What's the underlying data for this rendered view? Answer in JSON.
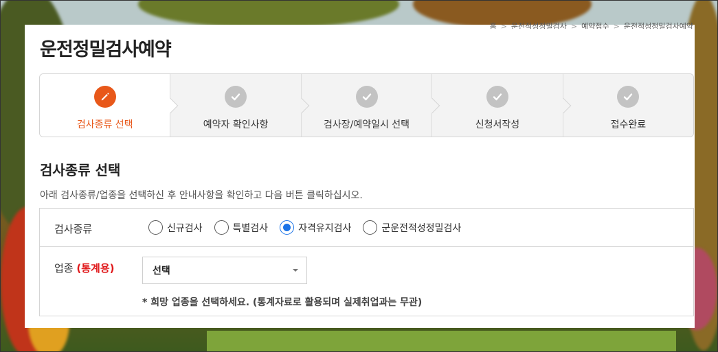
{
  "breadcrumb": [
    "홈",
    "운전적성정밀검사",
    "예약접수",
    "운전적성정밀검사예약"
  ],
  "page_title": "운전정밀검사예약",
  "steps": [
    {
      "label": "검사종류 선택",
      "icon": "pencil-icon",
      "active": true
    },
    {
      "label": "예약자 확인사항",
      "icon": "check-icon",
      "active": false
    },
    {
      "label": "검사장/예약일시 선택",
      "icon": "check-icon",
      "active": false
    },
    {
      "label": "신청서작성",
      "icon": "check-icon",
      "active": false
    },
    {
      "label": "접수완료",
      "icon": "check-icon",
      "active": false
    }
  ],
  "section": {
    "title": "검사종류 선택",
    "description": "아래 검사종류/업종을 선택하신 후 안내사항을 확인하고 다음 버튼 클릭하십시오."
  },
  "form": {
    "exam_type": {
      "label": "검사종류",
      "options": [
        "신규검사",
        "특별검사",
        "자격유지검사",
        "군운전적성정밀검사"
      ],
      "selected": "자격유지검사"
    },
    "industry": {
      "label": "업종",
      "label_note": "(통계용)",
      "select_value": "선택",
      "hint": "* 희망 업종을 선택하세요. (통계자료로 활용되며 실제취업과는 무관)"
    }
  },
  "colors": {
    "accent": "#e8581a",
    "radio_checked": "#1a73e8",
    "required_note": "#e0191b"
  }
}
